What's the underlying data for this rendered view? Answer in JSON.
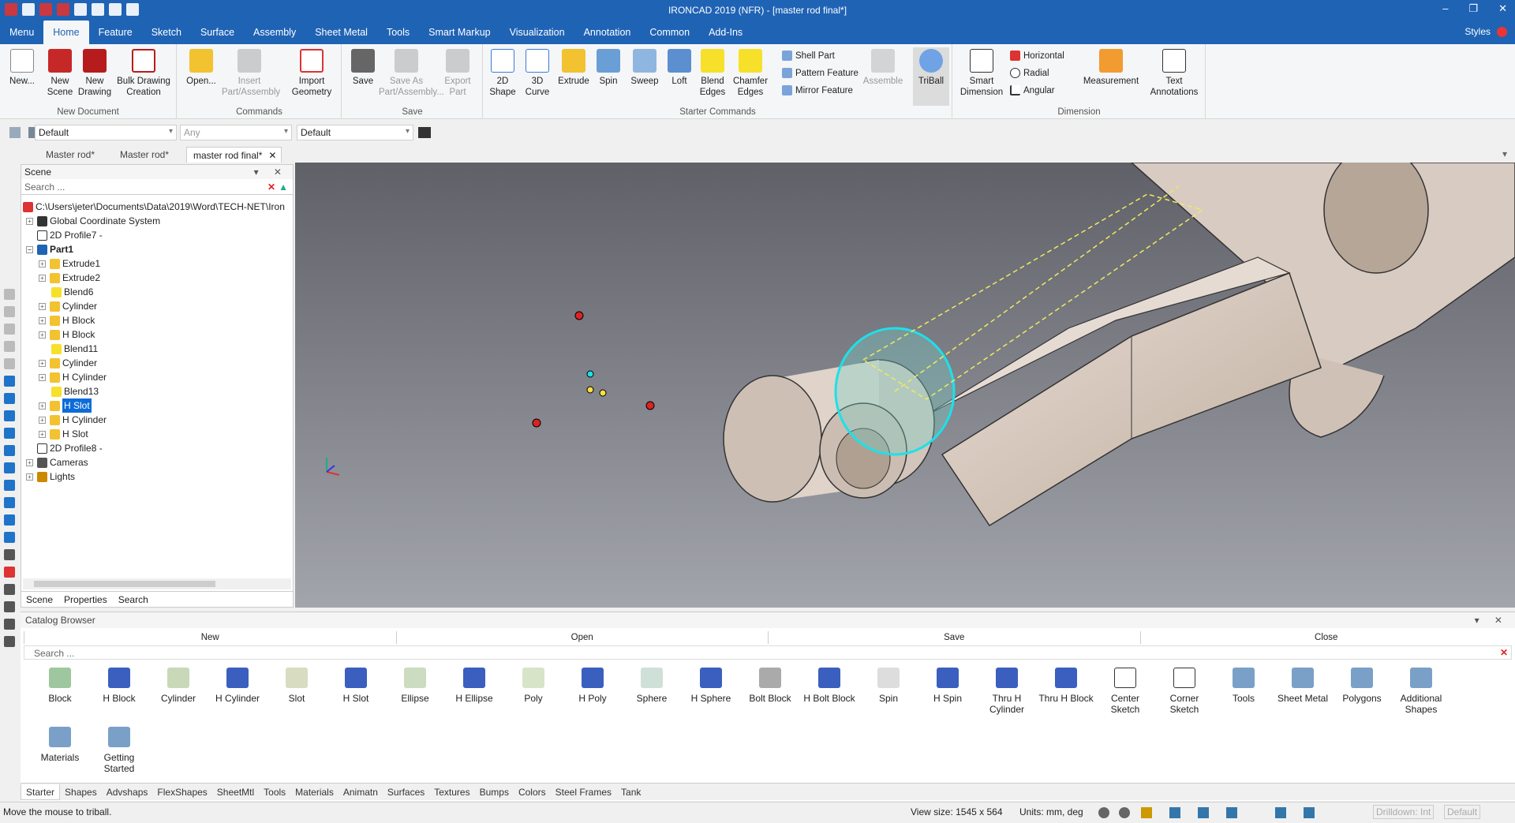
{
  "window": {
    "title": "IRONCAD 2019 (NFR) - [master rod final*]",
    "minimize": "–",
    "restore": "❐",
    "close": "✕"
  },
  "menubar": {
    "tabs": [
      "Menu",
      "Home",
      "Feature",
      "Sketch",
      "Surface",
      "Assembly",
      "Sheet Metal",
      "Tools",
      "Smart Markup",
      "Visualization",
      "Annotation",
      "Common",
      "Add-Ins"
    ],
    "active": "Home",
    "styles_label": "Styles"
  },
  "ribbon": {
    "groups": {
      "new_document": "New Document",
      "commands": "Commands",
      "save": "Save",
      "starter": "Starter Commands",
      "dimension": "Dimension"
    },
    "buttons": {
      "new": "New...",
      "new_scene": "New Scene",
      "new_drawing": "New Drawing",
      "bulk_drawing": "Bulk Drawing Creation",
      "open": "Open...",
      "insert_part": "Insert Part/Assembly",
      "import_geometry": "Import Geometry",
      "save": "Save",
      "save_as": "Save As Part/Assembly...",
      "export_part": "Export Part",
      "shape_2d": "2D Shape",
      "curve_3d": "3D Curve",
      "extrude": "Extrude",
      "spin": "Spin",
      "sweep": "Sweep",
      "loft": "Loft",
      "blend_edges": "Blend Edges",
      "chamfer_edges": "Chamfer Edges",
      "shell_part": "Shell Part",
      "pattern_feature": "Pattern Feature",
      "mirror_feature": "Mirror Feature",
      "assemble": "Assemble",
      "triball": "TriBall",
      "smart_dimension": "Smart Dimension",
      "horizontal": "Horizontal",
      "radial": "Radial",
      "angular": "Angular",
      "measurement": "Measurement",
      "text_annotations": "Text Annotations"
    }
  },
  "toolrow": {
    "combo1": "Default",
    "combo2": "Any",
    "combo3": "Default"
  },
  "doc_tabs": [
    "Master rod*",
    "Master rod*",
    "master rod final*"
  ],
  "doc_tab_active": "master rod final*",
  "scene_panel": {
    "title": "Scene",
    "search_placeholder": "Search ...",
    "tree": [
      "C:\\Users\\jeter\\Documents\\Data\\2019\\Word\\TECH-NET\\Iron",
      "Global Coordinate System",
      "2D Profile7 -",
      "Part1",
      "Extrude1",
      "Extrude2",
      "Blend6",
      "Cylinder",
      "H Block",
      "H Block",
      "Blend11",
      "Cylinder",
      "H Cylinder",
      "Blend13",
      "H Slot",
      "H Cylinder",
      "H Slot",
      "2D Profile8 -",
      "Cameras",
      "Lights"
    ],
    "bottom_tabs": [
      "Scene",
      "Properties",
      "Search"
    ]
  },
  "catalog": {
    "title": "Catalog Browser",
    "actions": [
      "New",
      "Open",
      "Save",
      "Close"
    ],
    "search_placeholder": "Search ...",
    "items": [
      "Block",
      "H Block",
      "Cylinder",
      "H Cylinder",
      "Slot",
      "H Slot",
      "Ellipse",
      "H Ellipse",
      "Poly",
      "H Poly",
      "Sphere",
      "H Sphere",
      "Bolt Block",
      "H Bolt Block",
      "Spin",
      "H Spin",
      "Thru H Cylinder",
      "Thru H Block",
      "Center Sketch",
      "Corner Sketch",
      "Tools",
      "Sheet Metal",
      "Polygons",
      "Additional Shapes",
      "Materials",
      "Getting Started"
    ],
    "tabs": [
      "Starter",
      "Shapes",
      "Advshaps",
      "FlexShapes",
      "SheetMtl",
      "Tools",
      "Materials",
      "Animatn",
      "Surfaces",
      "Textures",
      "Bumps",
      "Colors",
      "Steel Frames",
      "Tank"
    ],
    "active_tab": "Starter"
  },
  "status": {
    "message": "Move the mouse to triball.",
    "view_size": "View size: 1545 x  564",
    "units": "Units: mm, deg",
    "drilldown": "Drilldown: Int",
    "default": "Default"
  },
  "colors": {
    "brand": "#1f63b5",
    "selection": "#0d6cd8",
    "viewport_top": "#5f6068",
    "viewport_bottom": "#a3a5ad"
  }
}
